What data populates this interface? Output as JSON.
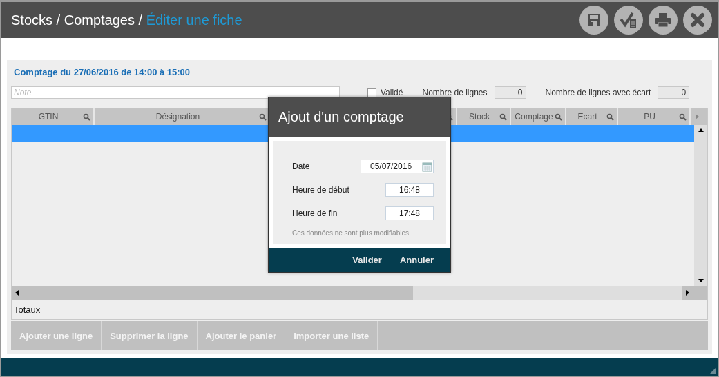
{
  "header": {
    "breadcrumb": "Stocks / Comptages /",
    "current": "Éditer une fiche",
    "actions": [
      {
        "kind": "save"
      },
      {
        "kind": "validate"
      },
      {
        "kind": "print"
      },
      {
        "kind": "close"
      }
    ]
  },
  "form": {
    "title": "Comptage du 27/06/2016 de 14:00 à 15:00",
    "note": {
      "placeholder": "Note"
    },
    "validated": {
      "label": "Validé",
      "checked": false
    },
    "line_count": {
      "label": "Nombre de lignes",
      "value": "0"
    },
    "gap_count": {
      "label": "Nombre de lignes avec écart",
      "value": "0"
    }
  },
  "table": {
    "columns": [
      "GTIN",
      "Désignation",
      "",
      "Stock",
      "Comptage",
      "Ecart",
      "PU"
    ],
    "rows": [
      {
        "selected": true
      }
    ],
    "totals_label": "Totaux"
  },
  "buttons": [
    "Ajouter une ligne",
    "Supprimer la ligne",
    "Ajouter le panier",
    "Importer une liste"
  ],
  "dialog": {
    "title": "Ajout d'un comptage",
    "fields": [
      {
        "label": "Date",
        "value": "05/07/2016",
        "kind": "date"
      },
      {
        "label": "Heure de début",
        "value": "16:48",
        "kind": "time"
      },
      {
        "label": "Heure de fin",
        "value": "17:48",
        "kind": "time"
      }
    ],
    "note": "Ces données ne sont plus modifiables",
    "buttons": [
      "Valider",
      "Annuler"
    ]
  }
}
